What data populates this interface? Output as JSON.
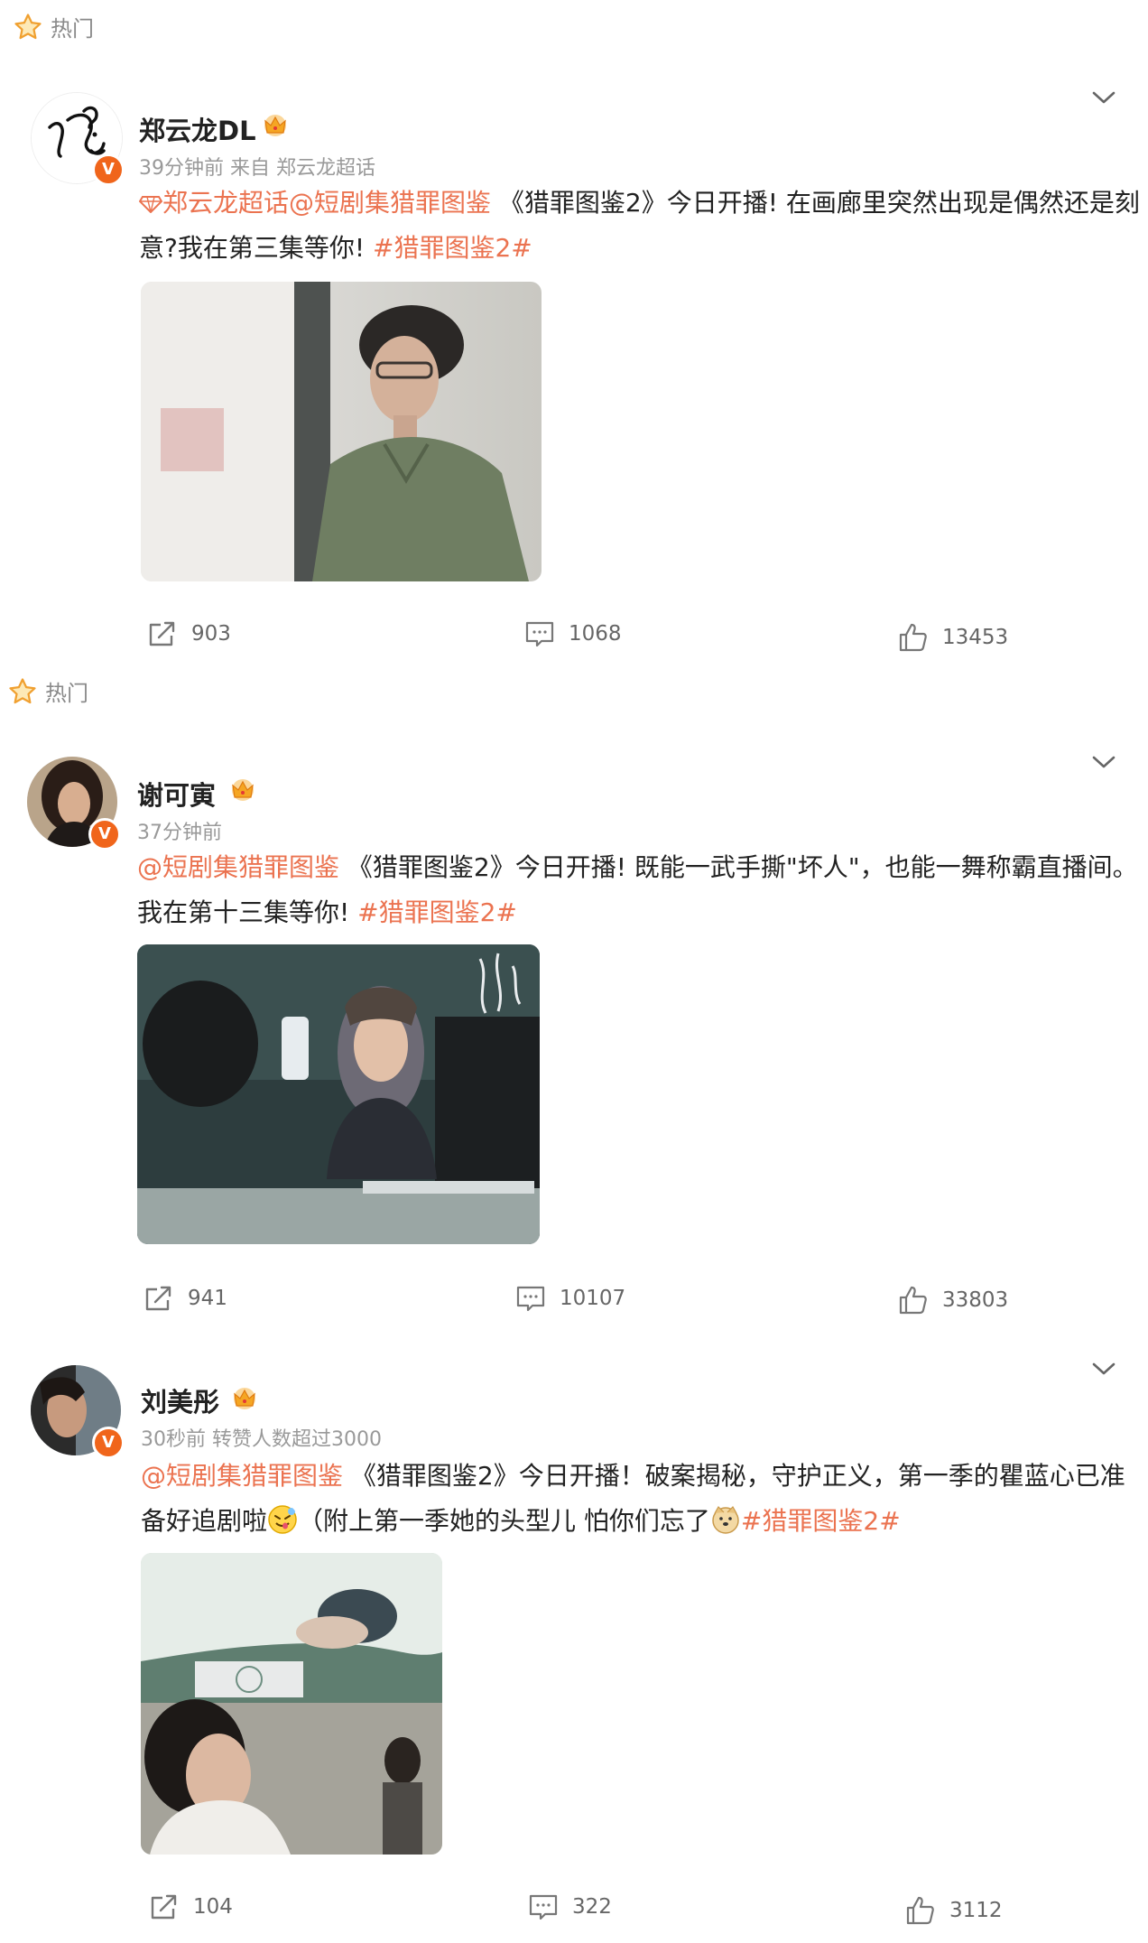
{
  "hot_label": "热门",
  "posts": [
    {
      "author": "郑云龙DL",
      "meta": "39分钟前  来自 郑云龙超话",
      "text": {
        "supertopic": "郑云龙超话",
        "mention": "@短剧集猎罪图鉴",
        "body": " 《猎罪图鉴2》今日开播! 在画廊里突然出现是偶然还是刻意?我在第三集等你! ",
        "hashtag": "#猎罪图鉴2#"
      },
      "reposts": "903",
      "comments": "1068",
      "likes": "13453"
    },
    {
      "author": "谢可寅",
      "meta": "37分钟前",
      "text": {
        "mention": "@短剧集猎罪图鉴",
        "body": " 《猎罪图鉴2》今日开播! 既能一武手撕\"坏人\"，也能一舞称霸直播间。我在第十三集等你! ",
        "hashtag": "#猎罪图鉴2#"
      },
      "reposts": "941",
      "comments": "10107",
      "likes": "33803"
    },
    {
      "author": "刘美彤",
      "meta": "30秒前 转赞人数超过3000",
      "text": {
        "mention": "@短剧集猎罪图鉴",
        "body1": " 《猎罪图鉴2》今日开播！破案揭秘，守护正义，第一季的瞿蓝心已准备好追剧啦",
        "body2": "（附上第一季她的头型儿 怕你们忘了",
        "hashtag": "#猎罪图鉴2#"
      },
      "reposts": "104",
      "comments": "322",
      "likes": "3112"
    }
  ],
  "colors": {
    "link": "#eb7350",
    "meta": "#999999",
    "badge": "#f0651b"
  }
}
